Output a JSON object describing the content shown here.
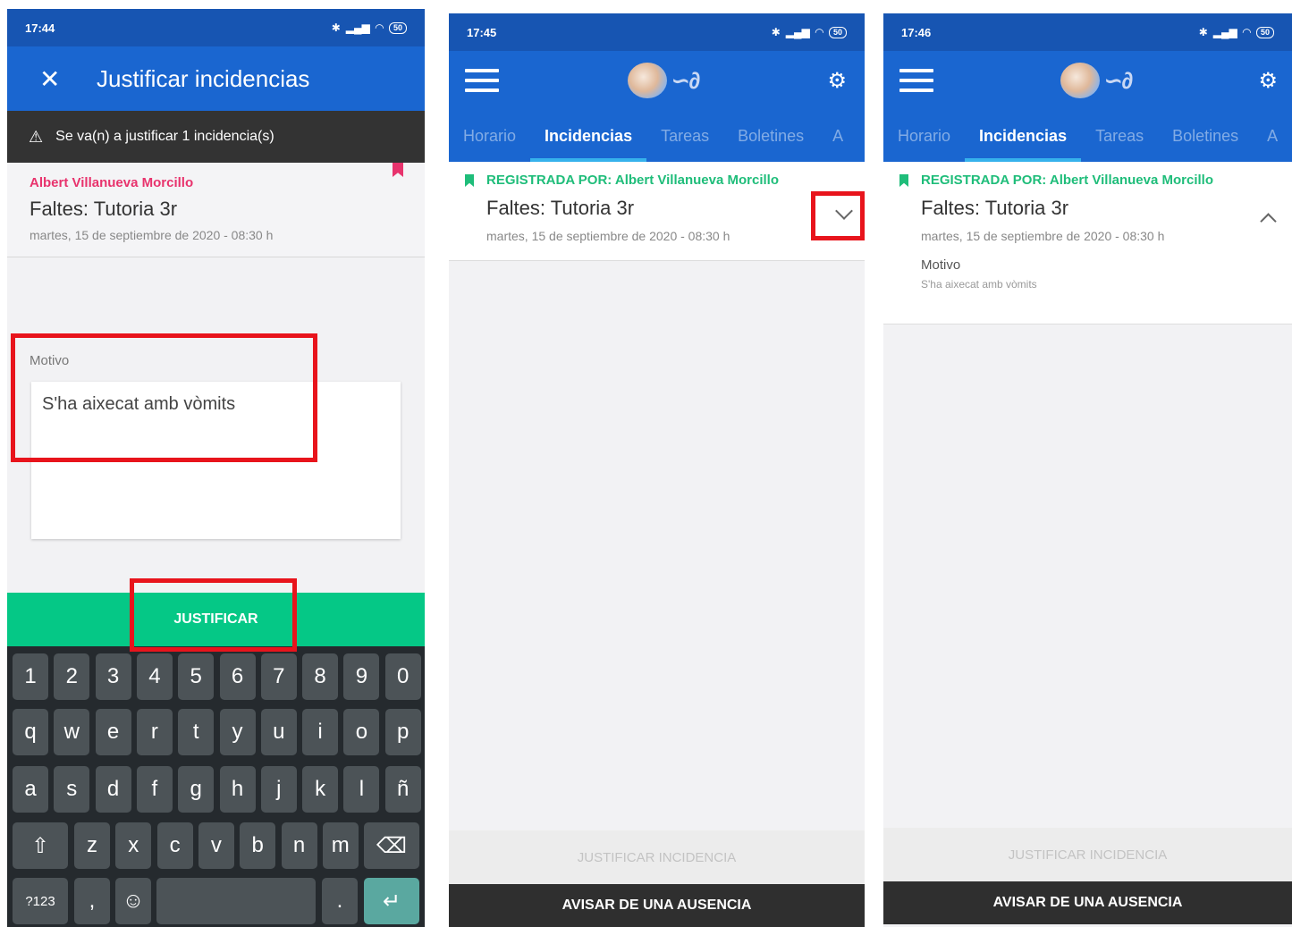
{
  "screen1": {
    "status": {
      "time": "17:44",
      "battery": "50"
    },
    "title": "Justificar incidencias",
    "banner": "Se va(n) a justificar 1 incidencia(s)",
    "author": "Albert Villanueva Morcillo",
    "incident_title": "Faltes: Tutoria 3r",
    "incident_date": "martes, 15 de septiembre de 2020 - 08:30 h",
    "motivo_label": "Motivo",
    "motivo_value": "S'ha aixecat amb vòmits",
    "justify_button": "JUSTIFICAR",
    "keyboard": {
      "row1": [
        "1",
        "2",
        "3",
        "4",
        "5",
        "6",
        "7",
        "8",
        "9",
        "0"
      ],
      "row2": [
        "q",
        "w",
        "e",
        "r",
        "t",
        "y",
        "u",
        "i",
        "o",
        "p"
      ],
      "row3": [
        "a",
        "s",
        "d",
        "f",
        "g",
        "h",
        "j",
        "k",
        "l",
        "ñ"
      ],
      "row4": [
        "z",
        "x",
        "c",
        "v",
        "b",
        "n",
        "m"
      ],
      "symbols_key": "?123",
      "comma_key": ",",
      "period_key": ".",
      "emoji_key": "☺",
      "shift_key": "⇧",
      "backspace_key": "⌫",
      "enter_key": "↵"
    }
  },
  "screen2": {
    "status": {
      "time": "17:45",
      "battery": "50"
    },
    "tabs": [
      "Horario",
      "Incidencias",
      "Tareas",
      "Boletines",
      "A"
    ],
    "registered_by": "REGISTRADA POR: Albert Villanueva Morcillo",
    "incident_title": "Faltes: Tutoria 3r",
    "incident_date": "martes, 15 de septiembre de 2020 - 08:30 h",
    "justify_incident": "JUSTIFICAR INCIDENCIA",
    "notify_absence": "AVISAR DE UNA AUSENCIA"
  },
  "screen3": {
    "status": {
      "time": "17:46",
      "battery": "50"
    },
    "tabs": [
      "Horario",
      "Incidencias",
      "Tareas",
      "Boletines",
      "A"
    ],
    "registered_by": "REGISTRADA POR: Albert Villanueva Morcillo",
    "incident_title": "Faltes: Tutoria 3r",
    "incident_date": "martes, 15 de septiembre de 2020 - 08:30 h",
    "motivo_label": "Motivo",
    "motivo_value": "S'ha aixecat amb vòmits",
    "justify_incident": "JUSTIFICAR INCIDENCIA",
    "notify_absence": "AVISAR DE UNA AUSENCIA"
  },
  "colors": {
    "primary": "#1a66d0",
    "statusbar": "#1755b2",
    "accent_green": "#1fbd7a",
    "highlight_red": "#e8141c",
    "author_pink": "#e8336d"
  }
}
